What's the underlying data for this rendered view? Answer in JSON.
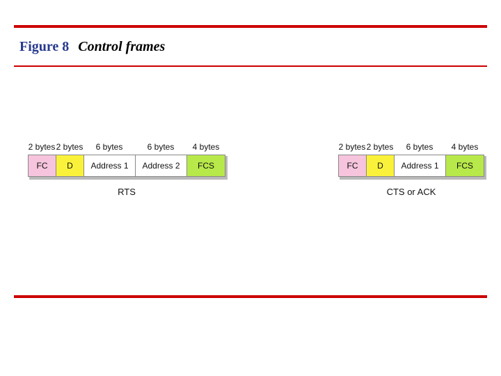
{
  "title": {
    "figure": "Figure 8",
    "caption": "Control frames"
  },
  "frames": [
    {
      "caption": "RTS",
      "fields": [
        {
          "size": "2 bytes",
          "label": "FC",
          "color": "pink",
          "w": "w-fc"
        },
        {
          "size": "2 bytes",
          "label": "D",
          "color": "yellow",
          "w": "w-d"
        },
        {
          "size": "6 bytes",
          "label": "Address 1",
          "color": "white",
          "w": "w-addr"
        },
        {
          "size": "6 bytes",
          "label": "Address 2",
          "color": "white",
          "w": "w-addr"
        },
        {
          "size": "4 bytes",
          "label": "FCS",
          "color": "green",
          "w": "w-fcs"
        }
      ]
    },
    {
      "caption": "CTS or ACK",
      "fields": [
        {
          "size": "2 bytes",
          "label": "FC",
          "color": "pink",
          "w": "w-fc"
        },
        {
          "size": "2 bytes",
          "label": "D",
          "color": "yellow",
          "w": "w-d"
        },
        {
          "size": "6 bytes",
          "label": "Address 1",
          "color": "white",
          "w": "w-addr"
        },
        {
          "size": "4 bytes",
          "label": "FCS",
          "color": "green",
          "w": "w-fcs"
        }
      ]
    }
  ]
}
